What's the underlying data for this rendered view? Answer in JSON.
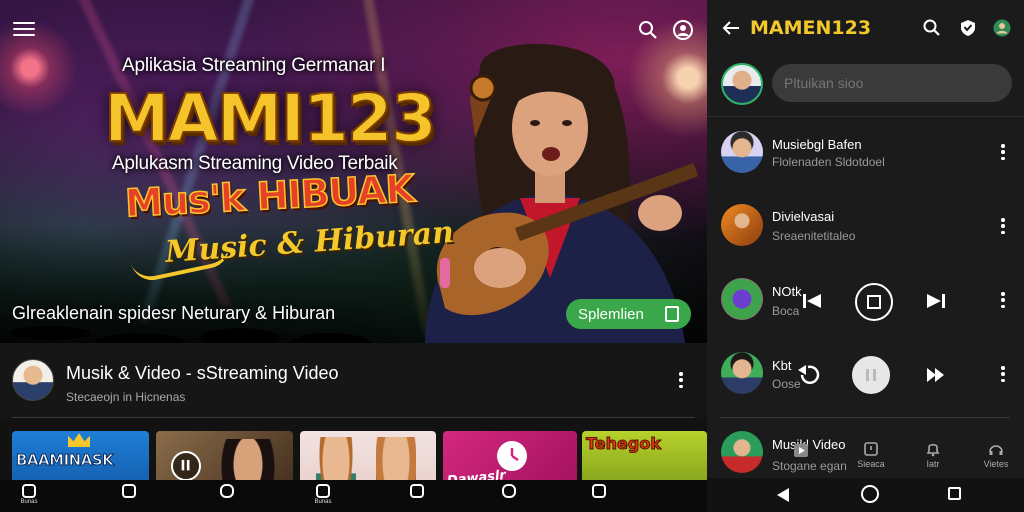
{
  "colors": {
    "accent_yellow": "#f4c82a",
    "subscribe_green": "#3aa84a",
    "background": "#121212",
    "panel": "#1b1b1b"
  },
  "left": {
    "hero": {
      "menu_icon": "hamburger-menu-icon",
      "search_icon": "search-icon",
      "account_icon": "account-icon",
      "tagline": "Aplikasia Streaming Germanar I",
      "big_title": "MAMI123",
      "subtagline": "Aplukasm Streaming Video Terbaik",
      "promo_text": "Mus'k HIBUAK",
      "music_script": "Music & Hiburan",
      "caption": "Glreaklenain spidesr Neturary & Hiburan",
      "subscribe_label": "Splemlien"
    },
    "channel": {
      "title": "Musik & Video - sStreaming Video",
      "subtitle": "Stecaeojn in Hicnenas"
    },
    "thumbnails": [
      {
        "label": "BAAMINASK"
      },
      {
        "label": ""
      },
      {
        "label": ""
      },
      {
        "label": "Dawaslr"
      },
      {
        "label": "Tehegok"
      }
    ],
    "bottom_nav": [
      {
        "label": "Bunas",
        "icon": "home-icon"
      },
      {
        "label": "",
        "icon": "library-icon"
      },
      {
        "label": "",
        "icon": "shorts-icon"
      },
      {
        "label": "Bunas",
        "icon": "home-icon"
      },
      {
        "label": "",
        "icon": "library-icon"
      },
      {
        "label": "",
        "icon": "shorts-icon"
      },
      {
        "label": "",
        "icon": "library-icon"
      }
    ]
  },
  "right": {
    "title": "MAMEN123",
    "comment_placeholder": "Pltuikan sioo",
    "items": [
      {
        "name": "Musiebgl Bafen",
        "sub": "Flolenaden Sldotdoel"
      },
      {
        "name": "Divielvasai",
        "sub": "Sreaenitetitaleo"
      },
      {
        "name": "NOtk",
        "sub": "Boca"
      },
      {
        "name": "Kbt",
        "sub": "Oose"
      },
      {
        "name": "Musikl Video",
        "sub": "Stogane egan"
      }
    ],
    "mini_nav": [
      {
        "label": "",
        "icon": "upload-icon"
      },
      {
        "label": "Sieaca",
        "icon": "timer-icon"
      },
      {
        "label": "Iatr",
        "icon": "bell-icon"
      },
      {
        "label": "Vietes",
        "icon": "headphones-icon"
      }
    ],
    "system_nav": {
      "back": "back-triangle-icon",
      "home": "home-circle-icon",
      "recent": "recent-square-icon"
    }
  }
}
